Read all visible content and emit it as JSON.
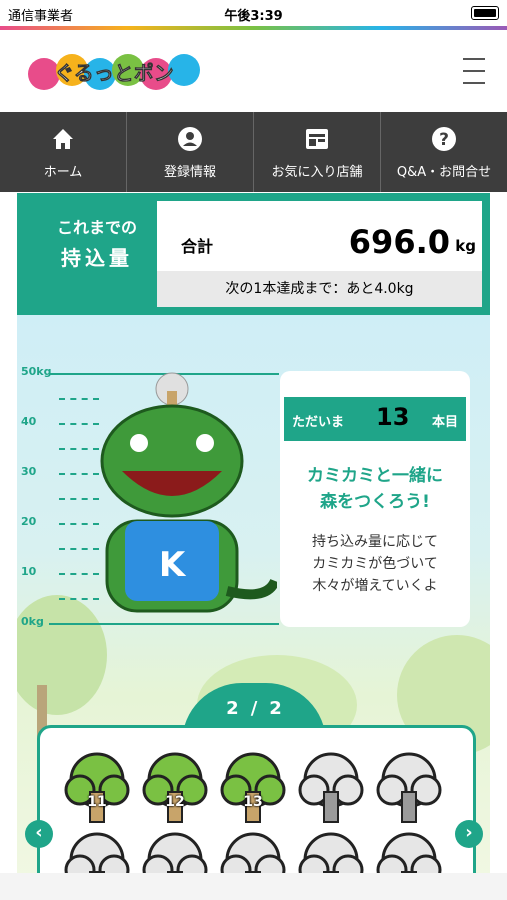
{
  "status_bar": {
    "carrier": "通信事業者",
    "time": "午後3:39"
  },
  "header": {
    "logo_text": "ぐるっとポン"
  },
  "nav": {
    "items": [
      {
        "label": "ホーム",
        "icon": "home-icon"
      },
      {
        "label": "登録情報",
        "icon": "user-icon"
      },
      {
        "label": "お気に入り店舗",
        "icon": "shop-icon"
      },
      {
        "label": "Q&A・お問合せ",
        "icon": "question-icon"
      }
    ]
  },
  "total": {
    "label_line1": "これまでの",
    "label_line2": "持込量",
    "sum_label": "合計",
    "value": "696.0",
    "unit": "kg",
    "next_goal": "次の1本達成まで：あと4.0kg"
  },
  "scale": {
    "ticks": [
      "50kg",
      "40",
      "30",
      "20",
      "10",
      "0kg"
    ]
  },
  "tree_card": {
    "prefix": "ただいま",
    "count": "13",
    "suffix": "本目",
    "slogan_line1": "カミカミと一緒に",
    "slogan_line2": "森をつくろう!",
    "desc_line1": "持ち込み量に応じて",
    "desc_line2": "カミカミが色づいて",
    "desc_line3": "木々が増えていくよ"
  },
  "pagination": {
    "current": "2",
    "separator": "/",
    "total": "2"
  },
  "trees": [
    {
      "number": "11",
      "colored": true
    },
    {
      "number": "12",
      "colored": true
    },
    {
      "number": "13",
      "colored": true
    },
    {
      "number": "",
      "colored": false
    },
    {
      "number": "",
      "colored": false
    },
    {
      "number": "",
      "colored": false
    },
    {
      "number": "",
      "colored": false
    },
    {
      "number": "",
      "colored": false
    },
    {
      "number": "",
      "colored": false
    },
    {
      "number": "",
      "colored": false
    }
  ],
  "colors": {
    "accent": "#1fa589",
    "nav_bg": "#3d3d3d",
    "tree_green": "#7ac143",
    "tree_grey": "#e6e6e6"
  }
}
